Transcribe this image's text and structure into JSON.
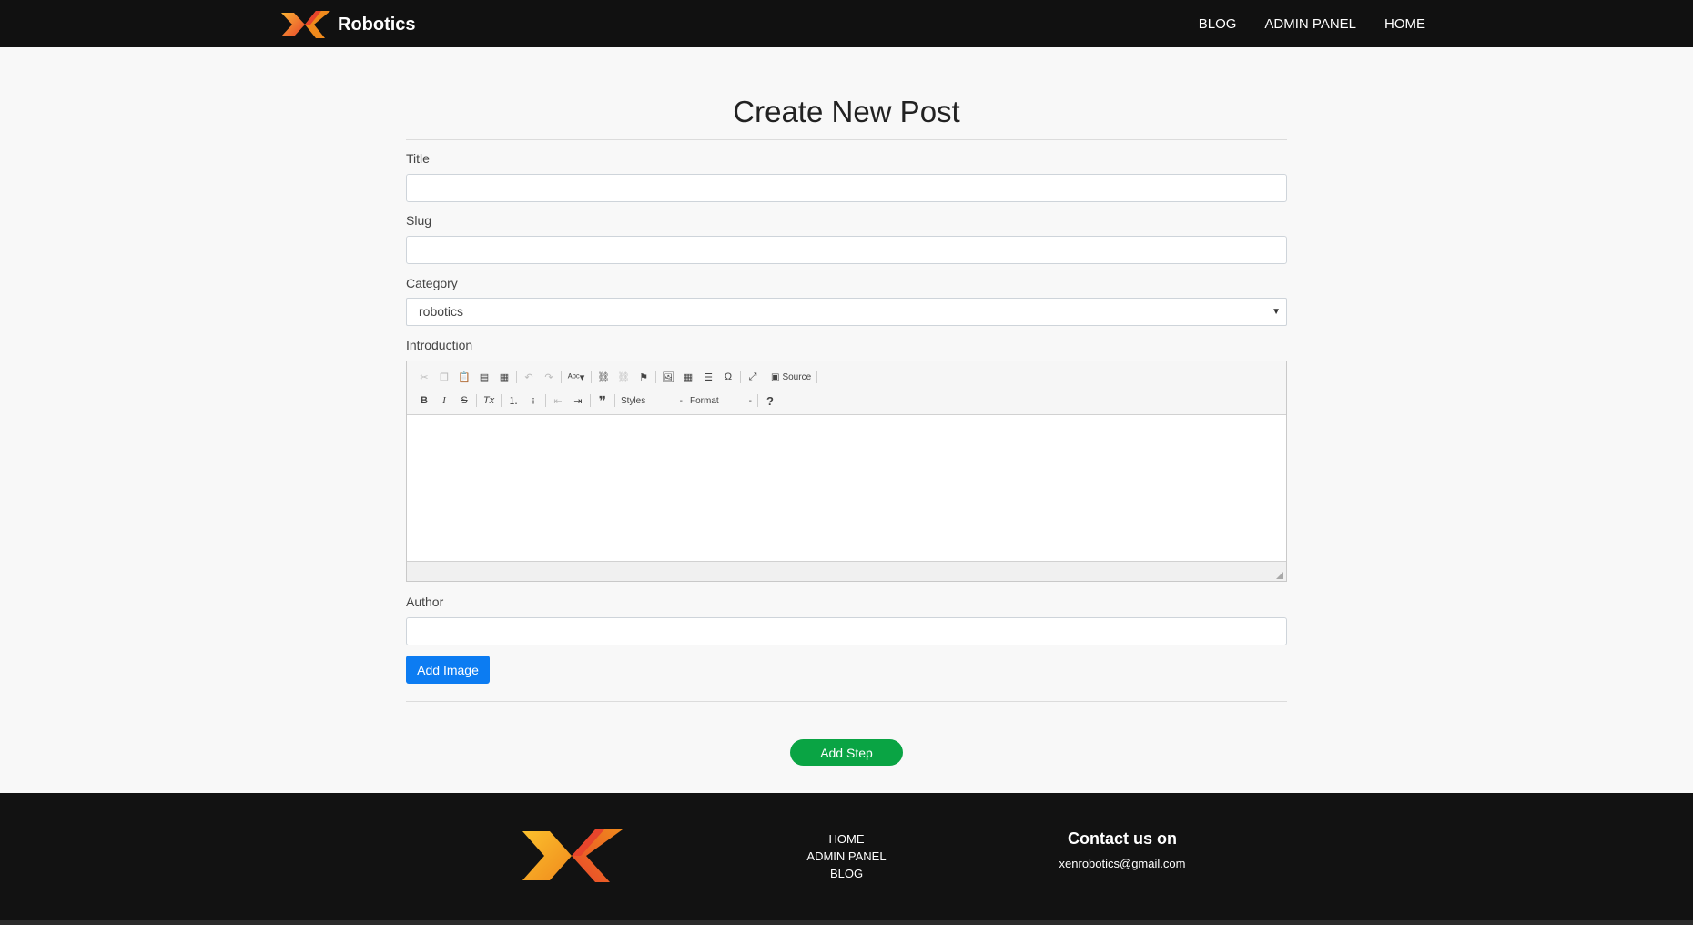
{
  "navbar": {
    "brand": "Robotics",
    "links": [
      "BLOG",
      "ADMIN PANEL",
      "HOME"
    ]
  },
  "form": {
    "heading": "Create New Post",
    "title_label": "Title",
    "title_value": "",
    "slug_label": "Slug",
    "slug_value": "",
    "category_label": "Category",
    "category_value": "robotics",
    "introduction_label": "Introduction",
    "author_label": "Author",
    "author_value": "",
    "add_image_label": "Add Image",
    "add_step_label": "Add Step"
  },
  "editor": {
    "source_label": "Source",
    "styles_label": "Styles",
    "format_label": "Format",
    "help_label": "?",
    "toolbar_row1": [
      "cut-icon",
      "copy-icon",
      "paste-icon",
      "paste-text-icon",
      "paste-word-icon",
      "undo-icon",
      "redo-icon",
      "spellcheck-icon",
      "link-icon",
      "unlink-icon",
      "anchor-icon",
      "image-icon",
      "table-icon",
      "horizontal-line-icon",
      "special-char-icon",
      "maximize-icon",
      "source-icon"
    ],
    "toolbar_row2": [
      "bold-icon",
      "italic-icon",
      "strikethrough-icon",
      "remove-format-icon",
      "numbered-list-icon",
      "bulleted-list-icon",
      "outdent-icon",
      "indent-icon",
      "blockquote-icon",
      "styles-combo",
      "format-combo",
      "help-icon"
    ]
  },
  "footer": {
    "links": [
      "HOME",
      "ADMIN PANEL",
      "BLOG"
    ],
    "contact_title": "Contact us on",
    "contact_email": "xenrobotics@gmail.com"
  },
  "colors": {
    "navbar_bg": "#111111",
    "primary_button": "#0c7cf2",
    "success_button": "#0aa444",
    "logo_orange": "#f08a1c",
    "logo_red": "#e8452c"
  }
}
